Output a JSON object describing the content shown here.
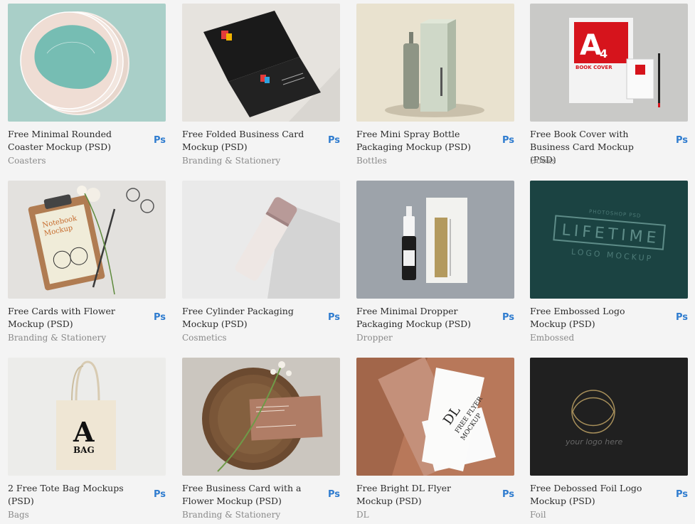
{
  "items": [
    {
      "title": "Free Minimal Rounded Coaster Mockup (PSD)",
      "category": "Coasters",
      "badge": "Ps"
    },
    {
      "title": "Free Folded Business Card Mockup (PSD)",
      "category": "Branding & Stationery",
      "badge": "Ps"
    },
    {
      "title": "Free Mini Spray Bottle Packaging Mockup (PSD)",
      "category": "Bottles",
      "badge": "Ps"
    },
    {
      "title": "Free Book Cover with Business Card Mockup (PSD)",
      "category": "Books",
      "badge": "Ps",
      "thumb_text": {
        "big": "A",
        "sub": "4",
        "label": "BOOK COVER"
      }
    },
    {
      "title": "Free Cards with Flower Mockup (PSD)",
      "category": "Branding & Stationery",
      "badge": "Ps",
      "thumb_text": {
        "line1": "Notebook",
        "line2": "Mockup"
      }
    },
    {
      "title": "Free Cylinder Packaging Mockup (PSD)",
      "category": "Cosmetics",
      "badge": "Ps"
    },
    {
      "title": "Free Minimal Dropper Packaging Mockup (PSD)",
      "category": "Dropper",
      "badge": "Ps"
    },
    {
      "title": "Free Embossed Logo Mockup (PSD)",
      "category": "Embossed",
      "badge": "Ps",
      "thumb_text": {
        "top": "PHOTOSHOP PSD",
        "main": "LIFETIME",
        "bottom": "LOGO MOCKUP"
      }
    },
    {
      "title": "2 Free Tote Bag Mockups (PSD)",
      "category": "Bags",
      "badge": "Ps",
      "thumb_text": {
        "big": "A",
        "word": "BAG"
      }
    },
    {
      "title": "Free Business Card with a Flower Mockup (PSD)",
      "category": "Branding & Stationery",
      "badge": "Ps"
    },
    {
      "title": "Free Bright DL Flyer Mockup (PSD)",
      "category": "DL",
      "badge": "Ps",
      "thumb_text": {
        "big": "DL",
        "line1": "FREE FLYER",
        "line2": "MOCKUP"
      }
    },
    {
      "title": "Free Debossed Foil Logo Mockup (PSD)",
      "category": "Foil",
      "badge": "Ps",
      "thumb_text": {
        "caption": "your logo here"
      }
    }
  ]
}
